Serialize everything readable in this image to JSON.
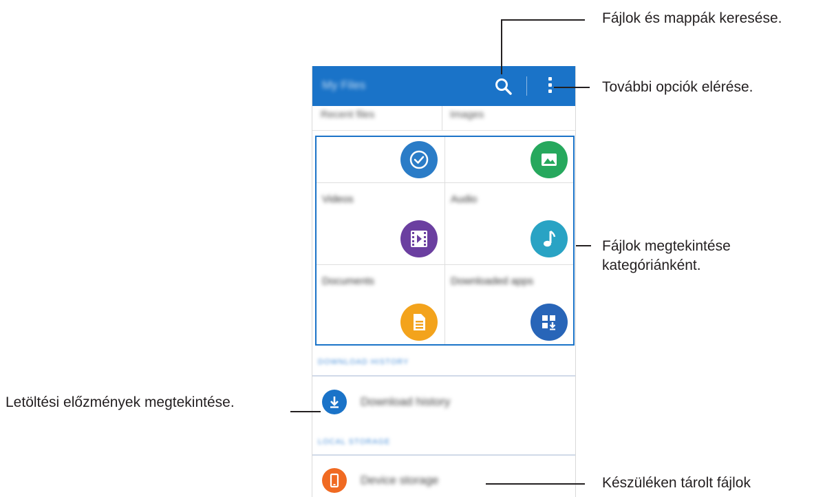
{
  "app": {
    "title": "My Files",
    "colors": {
      "appbar": "#1a73c8",
      "highlight": "#1a73c8"
    }
  },
  "tabs": [
    {
      "label": "Recent files"
    },
    {
      "label": "Images"
    }
  ],
  "categories": [
    {
      "label": "",
      "icon": "clock-icon",
      "color": "#2a7cc7"
    },
    {
      "label": "",
      "icon": "image-icon",
      "color": "#26a85d"
    },
    {
      "label": "Videos",
      "icon": "video-icon",
      "color": "#6b3fa0"
    },
    {
      "label": "Audio",
      "icon": "music-note-icon",
      "color": "#29a3c4"
    },
    {
      "label": "Documents",
      "icon": "document-icon",
      "color": "#f3a31c"
    },
    {
      "label": "Downloaded apps",
      "icon": "downloaded-apps-icon",
      "color": "#2865b8"
    }
  ],
  "download_section": {
    "header": "DOWNLOAD HISTORY",
    "item": {
      "label": "Download history",
      "icon": "download-icon",
      "color": "#1a73c8"
    }
  },
  "storage_section": {
    "header": "LOCAL STORAGE",
    "item": {
      "label": "Device storage",
      "icon": "phone-icon",
      "color": "#f06a22"
    }
  },
  "callouts": {
    "search": "Fájlok és mappák keresése.",
    "more": "További opciók elérése.",
    "categories_line1": "Fájlok megtekintése",
    "categories_line2": "kategóriánként.",
    "history": "Letöltési előzmények megtekintése.",
    "device": "Készüléken tárolt fájlok"
  }
}
